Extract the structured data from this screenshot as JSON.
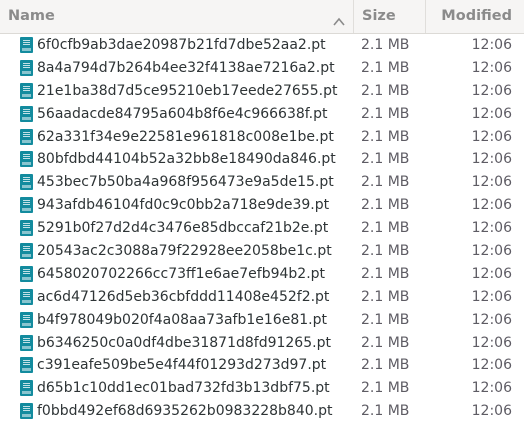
{
  "columns": {
    "name": "Name",
    "size": "Size",
    "modified": "Modified"
  },
  "sort": {
    "column": "name",
    "direction": "ascending",
    "icon": "sort-chevron-up-icon"
  },
  "file_icon": "binary-file-icon",
  "icon_color": "#138b9e",
  "files": [
    {
      "name": "6f0cfb9ab3dae20987b21fd7dbe52aa2.pt",
      "size": "2.1 MB",
      "modified": "12:06"
    },
    {
      "name": "8a4a794d7b264b4ee32f4138ae7216a2.pt",
      "size": "2.1 MB",
      "modified": "12:06"
    },
    {
      "name": "21e1ba38d7d5ce95210eb17eede27655.pt",
      "size": "2.1 MB",
      "modified": "12:06"
    },
    {
      "name": "56aadacde84795a604b8f6e4c966638f.pt",
      "size": "2.1 MB",
      "modified": "12:06"
    },
    {
      "name": "62a331f34e9e22581e961818c008e1be.pt",
      "size": "2.1 MB",
      "modified": "12:06"
    },
    {
      "name": "80bfdbd44104b52a32bb8e18490da846.pt",
      "size": "2.1 MB",
      "modified": "12:06"
    },
    {
      "name": "453bec7b50ba4a968f956473e9a5de15.pt",
      "size": "2.1 MB",
      "modified": "12:06"
    },
    {
      "name": "943afdb46104fd0c9c0bb2a718e9de39.pt",
      "size": "2.1 MB",
      "modified": "12:06"
    },
    {
      "name": "5291b0f27d2d4c3476e85dbccaf21b2e.pt",
      "size": "2.1 MB",
      "modified": "12:06"
    },
    {
      "name": "20543ac2c3088a79f22928ee2058be1c.pt",
      "size": "2.1 MB",
      "modified": "12:06"
    },
    {
      "name": "6458020702266cc73ff1e6ae7efb94b2.pt",
      "size": "2.1 MB",
      "modified": "12:06"
    },
    {
      "name": "ac6d47126d5eb36cbfddd11408e452f2.pt",
      "size": "2.1 MB",
      "modified": "12:06"
    },
    {
      "name": "b4f978049b020f4a08aa73afb1e16e81.pt",
      "size": "2.1 MB",
      "modified": "12:06"
    },
    {
      "name": "b6346250c0a0df4dbe31871d8fd91265.pt",
      "size": "2.1 MB",
      "modified": "12:06"
    },
    {
      "name": "c391eafe509be5e4f44f01293d273d97.pt",
      "size": "2.1 MB",
      "modified": "12:06"
    },
    {
      "name": "d65b1c10dd1ec01bad732fd3b13dbf75.pt",
      "size": "2.1 MB",
      "modified": "12:06"
    },
    {
      "name": "f0bbd492ef68d6935262b0983228b840.pt",
      "size": "2.1 MB",
      "modified": "12:06"
    }
  ]
}
